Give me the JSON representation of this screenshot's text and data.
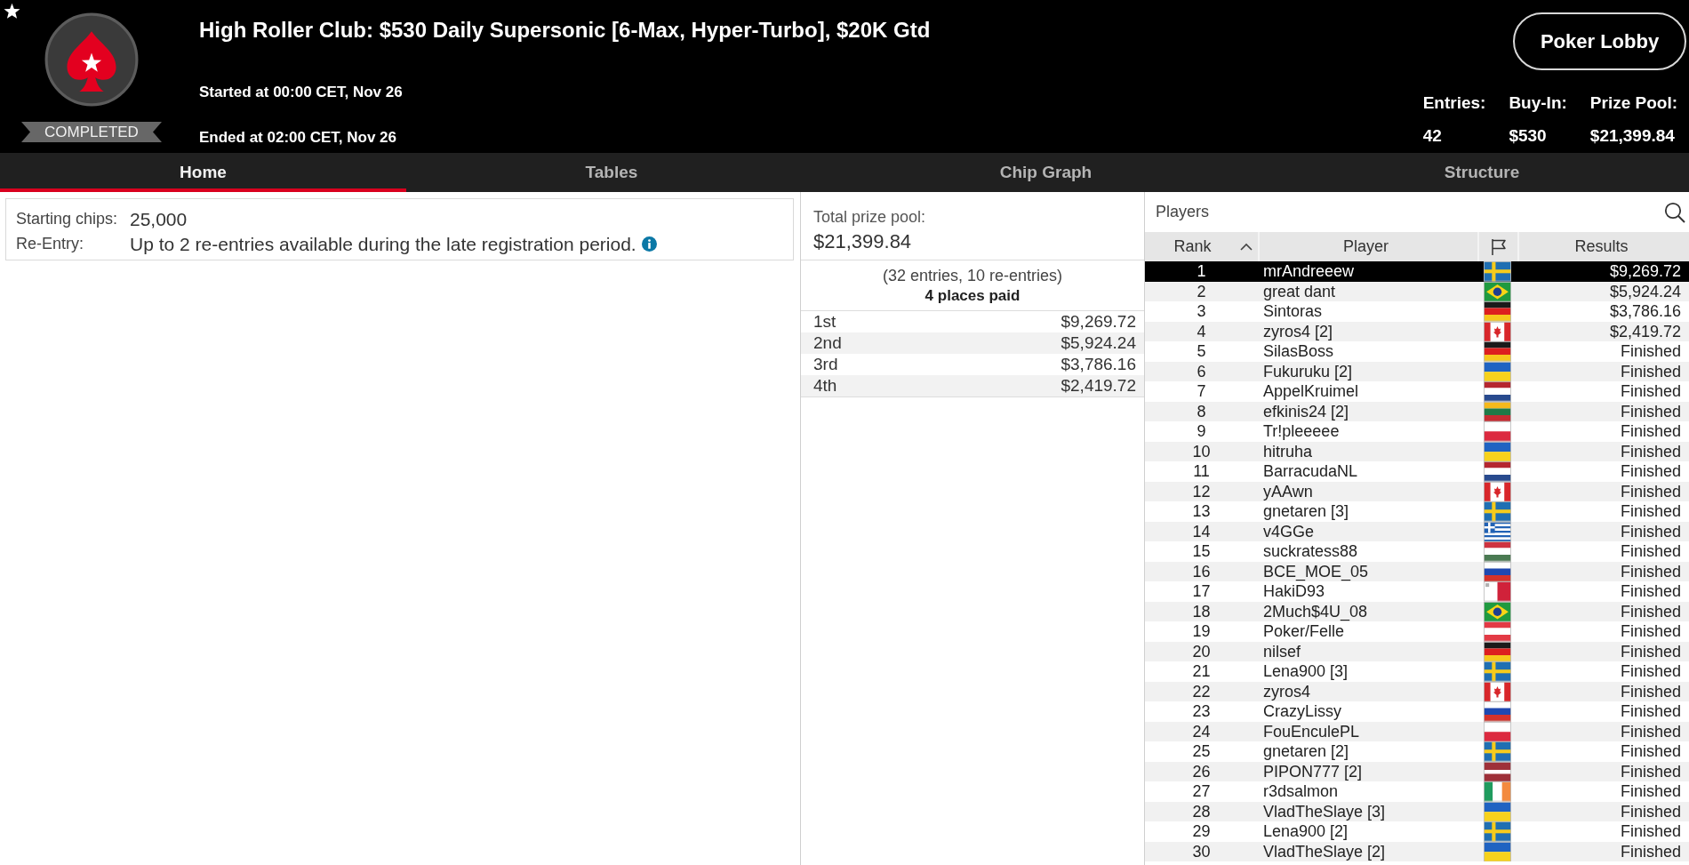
{
  "header": {
    "title": "High Roller Club: $530 Daily Supersonic [6-Max, Hyper-Turbo], $20K Gtd",
    "status": "COMPLETED",
    "started": "Started at 00:00 CET, Nov 26",
    "ended": "Ended at 02:00 CET, Nov 26",
    "lobby_button": "Poker Lobby",
    "stats": [
      {
        "label": "Entries:",
        "value": "42"
      },
      {
        "label": "Buy-In:",
        "value": "$530"
      },
      {
        "label": "Prize Pool:",
        "value": "$21,399.84"
      }
    ]
  },
  "tabs": [
    {
      "label": "Home",
      "selected": true
    },
    {
      "label": "Tables",
      "selected": false
    },
    {
      "label": "Chip Graph",
      "selected": false
    },
    {
      "label": "Structure",
      "selected": false
    }
  ],
  "info": {
    "rows": [
      {
        "label": "Starting chips:",
        "value": "25,000",
        "info_icon": false
      },
      {
        "label": "Re-Entry:",
        "value": "Up to 2 re-entries available during the late registration period.",
        "info_icon": true
      }
    ]
  },
  "prize_pool": {
    "label": "Total prize pool:",
    "amount": "$21,399.84",
    "entries": "(32 entries, 10 re-entries)",
    "places_paid": "4 places paid",
    "payouts": [
      {
        "place": "1st",
        "amount": "$9,269.72"
      },
      {
        "place": "2nd",
        "amount": "$5,924.24"
      },
      {
        "place": "3rd",
        "amount": "$3,786.16"
      },
      {
        "place": "4th",
        "amount": "$2,419.72"
      }
    ]
  },
  "players": {
    "title": "Players",
    "columns": [
      {
        "kind": "text",
        "label": "Rank",
        "sorted": true
      },
      {
        "kind": "text",
        "label": "Player",
        "sorted": false
      },
      {
        "kind": "flag",
        "sorted": false
      },
      {
        "kind": "text",
        "label": "Results",
        "sorted": false
      }
    ],
    "rows": [
      {
        "rank": "1",
        "player": "mrAndreeew",
        "flag": {
          "kind": "sweden"
        },
        "result": "$9,269.72",
        "selected": true
      },
      {
        "rank": "2",
        "player": "great dant",
        "flag": {
          "kind": "brazil"
        },
        "result": "$5,924.24",
        "selected": false
      },
      {
        "rank": "3",
        "player": "Sintoras",
        "flag": {
          "kind": "germany"
        },
        "result": "$3,786.16",
        "selected": false
      },
      {
        "rank": "4",
        "player": "zyros4 [2]",
        "flag": {
          "kind": "canada"
        },
        "result": "$2,419.72",
        "selected": false
      },
      {
        "rank": "5",
        "player": "SilasBoss",
        "flag": {
          "kind": "germany"
        },
        "result": "Finished",
        "selected": false
      },
      {
        "rank": "6",
        "player": "Fukuruku [2]",
        "flag": {
          "kind": "ukraine"
        },
        "result": "Finished",
        "selected": false
      },
      {
        "rank": "7",
        "player": "AppelKruimel",
        "flag": {
          "kind": "netherlands"
        },
        "result": "Finished",
        "selected": false
      },
      {
        "rank": "8",
        "player": "efkinis24 [2]",
        "flag": {
          "kind": "lithuania"
        },
        "result": "Finished",
        "selected": false
      },
      {
        "rank": "9",
        "player": "Tr!pleeeee",
        "flag": {
          "kind": "poland"
        },
        "result": "Finished",
        "selected": false
      },
      {
        "rank": "10",
        "player": "hitruha",
        "flag": {
          "kind": "ukraine"
        },
        "result": "Finished",
        "selected": false
      },
      {
        "rank": "11",
        "player": "BarracudaNL",
        "flag": {
          "kind": "netherlands"
        },
        "result": "Finished",
        "selected": false
      },
      {
        "rank": "12",
        "player": "yAAwn",
        "flag": {
          "kind": "canada"
        },
        "result": "Finished",
        "selected": false
      },
      {
        "rank": "13",
        "player": "gnetaren [3]",
        "flag": {
          "kind": "sweden"
        },
        "result": "Finished",
        "selected": false
      },
      {
        "rank": "14",
        "player": "v4GGe",
        "flag": {
          "kind": "greece"
        },
        "result": "Finished",
        "selected": false
      },
      {
        "rank": "15",
        "player": "suckratess88",
        "flag": {
          "kind": "hungary"
        },
        "result": "Finished",
        "selected": false
      },
      {
        "rank": "16",
        "player": "BCE_MOE_05",
        "flag": {
          "kind": "russia"
        },
        "result": "Finished",
        "selected": false
      },
      {
        "rank": "17",
        "player": "HakiD93",
        "flag": {
          "kind": "malta"
        },
        "result": "Finished",
        "selected": false
      },
      {
        "rank": "18",
        "player": "2Much$4U_08",
        "flag": {
          "kind": "brazil"
        },
        "result": "Finished",
        "selected": false
      },
      {
        "rank": "19",
        "player": "Poker/Felle",
        "flag": {
          "kind": "austria"
        },
        "result": "Finished",
        "selected": false
      },
      {
        "rank": "20",
        "player": "nilsef",
        "flag": {
          "kind": "germany"
        },
        "result": "Finished",
        "selected": false
      },
      {
        "rank": "21",
        "player": "Lena900 [3]",
        "flag": {
          "kind": "sweden"
        },
        "result": "Finished",
        "selected": false
      },
      {
        "rank": "22",
        "player": "zyros4",
        "flag": {
          "kind": "canada"
        },
        "result": "Finished",
        "selected": false
      },
      {
        "rank": "23",
        "player": "CrazyLissy",
        "flag": {
          "kind": "russia"
        },
        "result": "Finished",
        "selected": false
      },
      {
        "rank": "24",
        "player": "FouEnculePL",
        "flag": {
          "kind": "poland"
        },
        "result": "Finished",
        "selected": false
      },
      {
        "rank": "25",
        "player": "gnetaren [2]",
        "flag": {
          "kind": "sweden"
        },
        "result": "Finished",
        "selected": false
      },
      {
        "rank": "26",
        "player": "PIPON777 [2]",
        "flag": {
          "kind": "latvia"
        },
        "result": "Finished",
        "selected": false
      },
      {
        "rank": "27",
        "player": "r3dsalmon",
        "flag": {
          "kind": "ireland"
        },
        "result": "Finished",
        "selected": false
      },
      {
        "rank": "28",
        "player": "VladTheSlaye [3]",
        "flag": {
          "kind": "ukraine"
        },
        "result": "Finished",
        "selected": false
      },
      {
        "rank": "29",
        "player": "Lena900 [2]",
        "flag": {
          "kind": "sweden"
        },
        "result": "Finished",
        "selected": false
      },
      {
        "rank": "30",
        "player": "VladTheSlaye [2]",
        "flag": {
          "kind": "ukraine"
        },
        "result": "Finished",
        "selected": false
      }
    ]
  }
}
